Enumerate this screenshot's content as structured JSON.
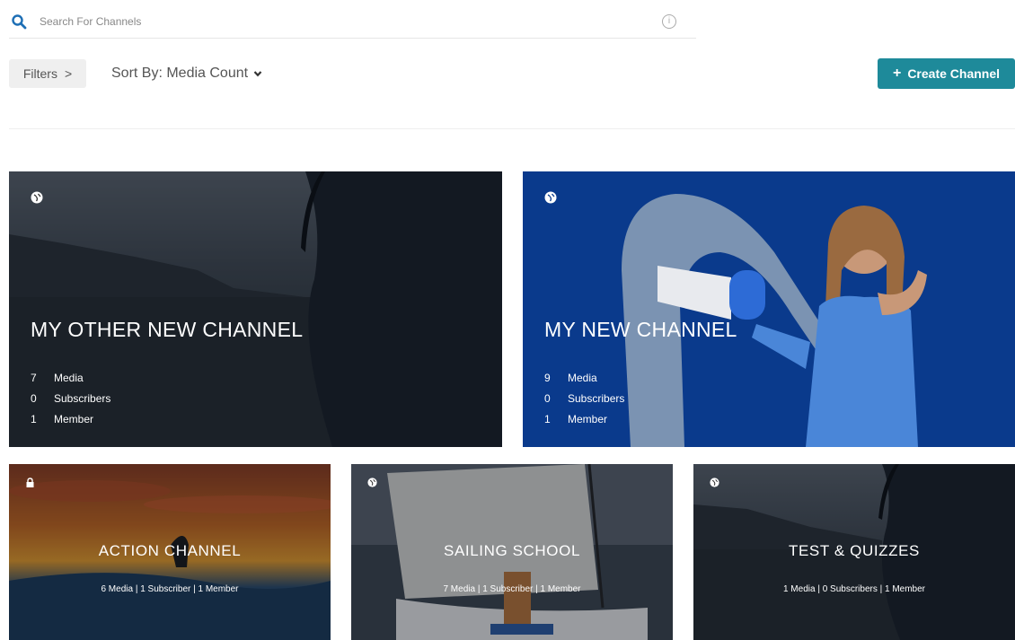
{
  "search": {
    "placeholder": "Search For Channels"
  },
  "toolbar": {
    "filters_label": "Filters",
    "filters_arrow": ">",
    "sort_label": "Sort By: Media Count",
    "create_label": "Create Channel",
    "create_icon": "+"
  },
  "colors": {
    "accent": "#1e8a9a",
    "banner_blue": "#0a3a8c"
  },
  "channels": [
    {
      "title": "MY OTHER NEW CHANNEL",
      "privacy_icon": "globe-icon",
      "media": "7",
      "media_label": "Media",
      "subscribers": "0",
      "subscribers_label": "Subscribers",
      "members": "1",
      "members_label": "Member"
    },
    {
      "title": "MY NEW CHANNEL",
      "privacy_icon": "globe-icon",
      "media": "9",
      "media_label": "Media",
      "subscribers": "0",
      "subscribers_label": "Subscribers",
      "members": "1",
      "members_label": "Member"
    },
    {
      "title": "ACTION CHANNEL",
      "privacy_icon": "lock-icon",
      "meta": "6 Media |  1 Subscriber  |  1 Member"
    },
    {
      "title": "SAILING SCHOOL",
      "privacy_icon": "globe-icon",
      "meta": "7 Media |  1 Subscriber  |  1 Member"
    },
    {
      "title": "TEST & QUIZZES",
      "privacy_icon": "globe-icon",
      "meta": "1 Media |  0 Subscribers  |  1 Member"
    }
  ]
}
